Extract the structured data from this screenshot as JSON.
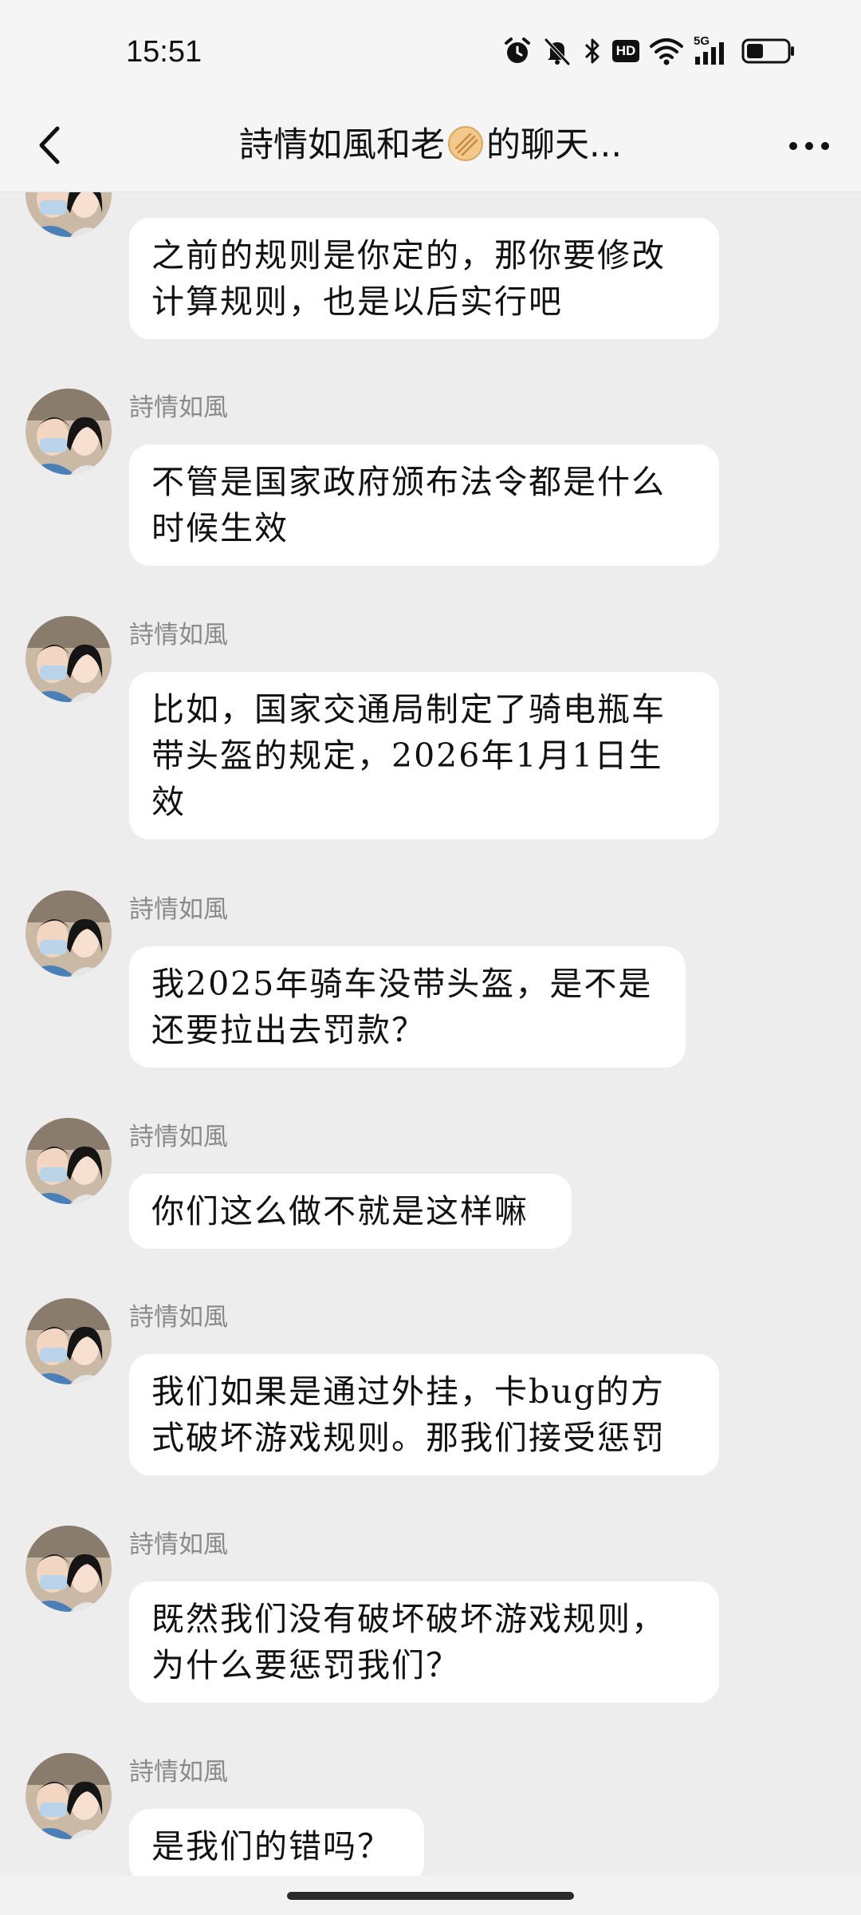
{
  "status_bar": {
    "time": "15:51",
    "icons": [
      "alarm-icon",
      "mute-icon",
      "bluetooth-icon",
      "hd-icon",
      "wifi-icon",
      "5g-signal-icon",
      "battery-icon"
    ],
    "hd_label": "HD",
    "network_label": "5G"
  },
  "nav": {
    "title": "詩情如風和老",
    "title_suffix": "的聊天...",
    "back_icon": "chevron-left-icon",
    "more_icon": "more-dots-icon"
  },
  "messages": [
    {
      "sender": "",
      "text": "之前的规则是你定的，那你要修改计算规则，也是以后实行吧"
    },
    {
      "sender": "詩情如風",
      "text": "不管是国家政府颁布法令都是什么时候生效"
    },
    {
      "sender": "詩情如風",
      "text": "比如，国家交通局制定了骑电瓶车带头盔的规定，2026年1月1日生效"
    },
    {
      "sender": "詩情如風",
      "text": "我2025年骑车没带头盔，是不是还要拉出去罚款？"
    },
    {
      "sender": "詩情如風",
      "text": "你们这么做不就是这样嘛"
    },
    {
      "sender": "詩情如風",
      "text": "我们如果是通过外挂，卡bug的方式破坏游戏规则。那我们接受惩罚"
    },
    {
      "sender": "詩情如風",
      "text": "既然我们没有破坏破坏游戏规则，为什么要惩罚我们？"
    },
    {
      "sender": "詩情如風",
      "text": "是我们的错吗？"
    }
  ],
  "colors": {
    "background": "#ededed",
    "bubble": "#ffffff",
    "sender_name": "#8a8a8a",
    "emoji_accent": "#f2c98a"
  }
}
